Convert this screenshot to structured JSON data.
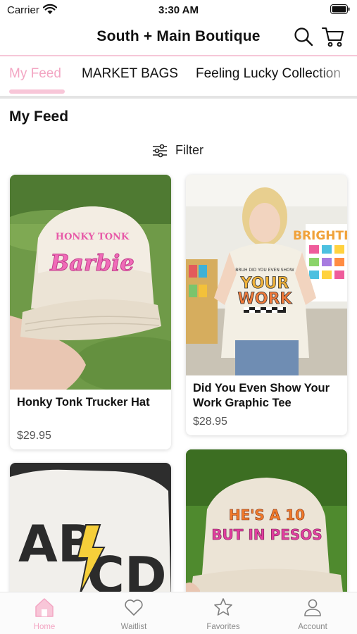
{
  "status_bar": {
    "carrier": "Carrier",
    "time": "3:30 AM"
  },
  "header": {
    "title": "South + Main Boutique",
    "search_icon": "search-icon",
    "cart_icon": "cart-icon"
  },
  "tabs": [
    {
      "label": "My Feed",
      "active": true
    },
    {
      "label": "MARKET BAGS",
      "active": false
    },
    {
      "label": "Feeling Lucky Collection",
      "active": false
    }
  ],
  "feed": {
    "title": "My Feed",
    "filter_label": "Filter",
    "products": [
      {
        "name": "Honky Tonk Trucker Hat",
        "price": "$29.95",
        "image_text": [
          "HONKY TONK",
          "Barbie"
        ]
      },
      {
        "name": "Did You Even Show Your Work Graphic Tee",
        "price": "$28.95",
        "image_text": [
          "BRUH DID YOU EVEN SHOW",
          "YOUR",
          "WORK",
          "BRIGHTES"
        ]
      },
      {
        "name": "",
        "price": "",
        "image_text": [
          "AB",
          "CD"
        ]
      },
      {
        "name": "",
        "price": "",
        "image_text": [
          "HE'S A 10",
          "BUT IN PESOS"
        ]
      }
    ]
  },
  "tabbar": [
    {
      "label": "Home",
      "icon": "home-icon",
      "active": true
    },
    {
      "label": "Waitlist",
      "icon": "heart-icon",
      "active": false
    },
    {
      "label": "Favorites",
      "icon": "star-icon",
      "active": false
    },
    {
      "label": "Account",
      "icon": "person-icon",
      "active": false
    }
  ],
  "colors": {
    "accent": "#f3a6c3",
    "accent_light": "#f8c6d8",
    "header_line": "#f6c7d8"
  }
}
